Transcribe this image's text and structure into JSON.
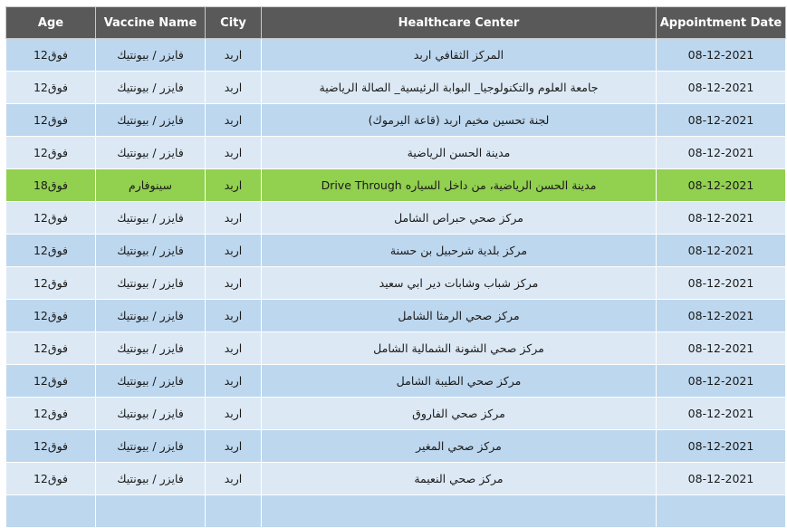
{
  "header": {
    "age": "Age",
    "vaccine": "Vaccine Name",
    "city": "City",
    "center": "Healthcare Center",
    "date": "Appointment Date"
  },
  "colors": {
    "header_bg": "#595959",
    "row_light": "#dce9f5",
    "row_dark": "#bdd7ee",
    "row_highlight": "#92d050"
  },
  "rows": [
    {
      "age": "فوق12",
      "vaccine": "فايزر / بيونتيك",
      "city": "اربد",
      "center": "المركز الثقافي اربد",
      "date": "08-12-2021"
    },
    {
      "age": "فوق12",
      "vaccine": "فايزر / بيونتيك",
      "city": "اربد",
      "center": "جامعة العلوم والتكنولوجيا_ البوابة الرئيسية_ الصالة الرياضية",
      "date": "08-12-2021"
    },
    {
      "age": "فوق12",
      "vaccine": "فايزر / بيونتيك",
      "city": "اربد",
      "center": "لجنة تحسين مخيم اربد (قاعة اليرموك)",
      "date": "08-12-2021"
    },
    {
      "age": "فوق12",
      "vaccine": "فايزر / بيونتيك",
      "city": "اربد",
      "center": "مدينة الحسن الرياضية",
      "date": "08-12-2021"
    },
    {
      "age": "فوق18",
      "vaccine": "سينوفارم",
      "city": "اربد",
      "center": "مدينة الحسن الرياضية، من داخل السياره Drive Through",
      "date": "08-12-2021",
      "highlight": true
    },
    {
      "age": "فوق12",
      "vaccine": "فايزر / بيونتيك",
      "city": "اربد",
      "center": "مركز صحي حبراص الشامل",
      "date": "08-12-2021"
    },
    {
      "age": "فوق12",
      "vaccine": "فايزر / بيونتيك",
      "city": "اربد",
      "center": "مركز بلدية شرحبيل بن حسنة",
      "date": "08-12-2021"
    },
    {
      "age": "فوق12",
      "vaccine": "فايزر / بيونتيك",
      "city": "اربد",
      "center": "مركز شباب وشابات دير ابي سعيد",
      "date": "08-12-2021"
    },
    {
      "age": "فوق12",
      "vaccine": "فايزر / بيونتيك",
      "city": "اربد",
      "center": "مركز صحي الرمثا الشامل",
      "date": "08-12-2021"
    },
    {
      "age": "فوق12",
      "vaccine": "فايزر / بيونتيك",
      "city": "اربد",
      "center": "مركز صحي الشونة الشمالية الشامل",
      "date": "08-12-2021"
    },
    {
      "age": "فوق12",
      "vaccine": "فايزر / بيونتيك",
      "city": "اربد",
      "center": "مركز صحي الطيبة الشامل",
      "date": "08-12-2021"
    },
    {
      "age": "فوق12",
      "vaccine": "فايزر / بيونتيك",
      "city": "اربد",
      "center": "مركز صحي الفاروق",
      "date": "08-12-2021"
    },
    {
      "age": "فوق12",
      "vaccine": "فايزر / بيونتيك",
      "city": "اربد",
      "center": "مركز صحي المغير",
      "date": "08-12-2021"
    },
    {
      "age": "فوق12",
      "vaccine": "فايزر / بيونتيك",
      "city": "اربد",
      "center": "مركز صحي النعيمة",
      "date": "08-12-2021"
    },
    {
      "age": "",
      "vaccine": "",
      "city": "",
      "center": "",
      "date": ""
    }
  ]
}
